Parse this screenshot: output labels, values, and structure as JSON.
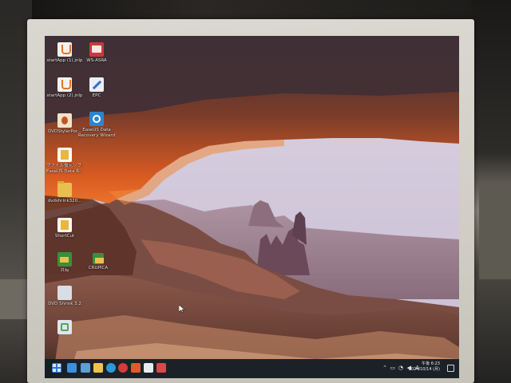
{
  "desktop_icons": [
    {
      "label": "startApp (1).jnlp",
      "icon": "java-icon"
    },
    {
      "label": "WS-ASRA",
      "icon": "ws-asra-icon"
    },
    {
      "label": "startApp (2).jnlp",
      "icon": "java-icon"
    },
    {
      "label": "EPC",
      "icon": "epc-icon"
    },
    {
      "label": "DVDStylerPor...",
      "icon": "dvdstyler-icon"
    },
    {
      "label": "EaseUS Data",
      "label2": "Recovery Wizard",
      "icon": "easeus-icon"
    },
    {
      "label": "ファイル復元ソフト",
      "label2": "EaseUS Data R...",
      "icon": "document-icon"
    },
    {
      "label": "dvdshrink320...",
      "icon": "folder-icon"
    },
    {
      "label": "ShortCut",
      "icon": "shortcut-icon"
    },
    {
      "label": "共有",
      "icon": "shared-folder-icon"
    },
    {
      "label": "CRUPICA",
      "icon": "crupica-icon"
    },
    {
      "label": "DVD Shrink 3.2",
      "icon": "dvd-shrink-icon"
    },
    {
      "label": "",
      "icon": "recycle-bin-icon"
    }
  ],
  "taskbar": {
    "apps": [
      "start-icon",
      "search-icon",
      "task-view-icon",
      "explorer-icon",
      "edge-icon",
      "vivaldi-icon",
      "brave-icon",
      "pen-icon",
      "snip-icon"
    ],
    "tray_letter": "A",
    "clock_time": "午後 6:23",
    "clock_date": "2024/10/14 (月)"
  },
  "colors": {
    "taskbar_bg": "#141c24",
    "bezel": "#d5d3ca"
  }
}
